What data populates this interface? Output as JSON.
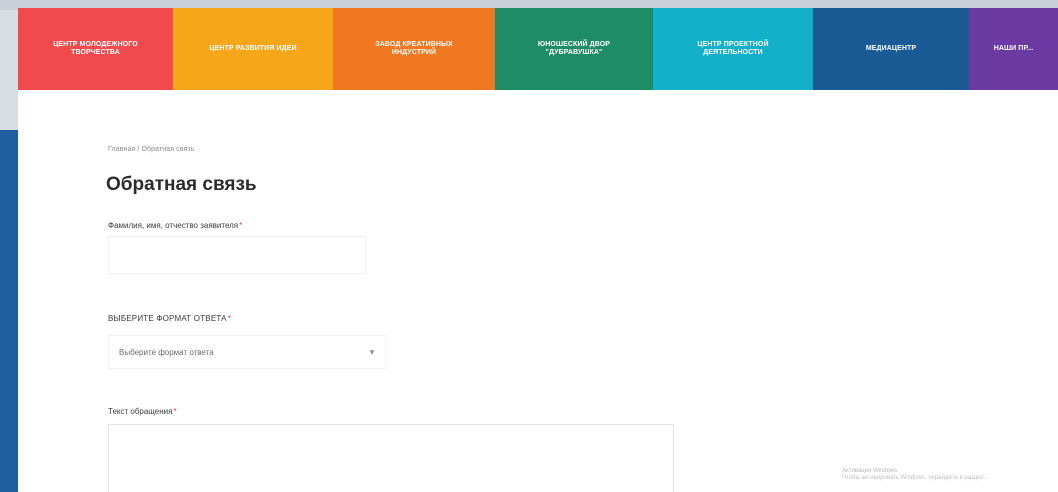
{
  "topnav": {
    "items": [
      {
        "label": "ЦЕНТР МОЛОДЕЖНОГО\nТВОРЧЕСТВА",
        "color": "#f14a4d"
      },
      {
        "label": "ЦЕНТР РАЗВИТИЯ ИДЕИ",
        "color": "#f6a619"
      },
      {
        "label": "ЗАВОД КРЕАТИВНЫХ\nИНДУСТРИЙ",
        "color": "#f07820"
      },
      {
        "label": "ЮНОШЕСКИЙ ДВОР\n\"ДУБРАВУШКА\"",
        "color": "#1e8c67"
      },
      {
        "label": "ЦЕНТР ПРОЕКТНОЙ\nДЕЯТЕЛЬНОСТИ",
        "color": "#12b1c9"
      },
      {
        "label": "МЕДИАЦЕНТР",
        "color": "#1b5b95"
      },
      {
        "label": "НАШИ ПР...",
        "color": "#6b3aa3"
      }
    ]
  },
  "breadcrumb": "Главная / Обратная связь",
  "page_title": "Обратная связь",
  "form": {
    "applicant_label": "Фамилия, имя, отчество заявителя",
    "required_mark": "*",
    "response_format_label": "ВЫБЕРИТЕ ФОРМАТ ОТВЕТА",
    "response_format_value": "Выберите формат ответа",
    "message_label": "Текст обращения",
    "select_chevron": "▾"
  },
  "footer_faint": {
    "line1": "Активация Windows",
    "line2": "Чтобы активировать Windows, перейдите в раздел..."
  }
}
